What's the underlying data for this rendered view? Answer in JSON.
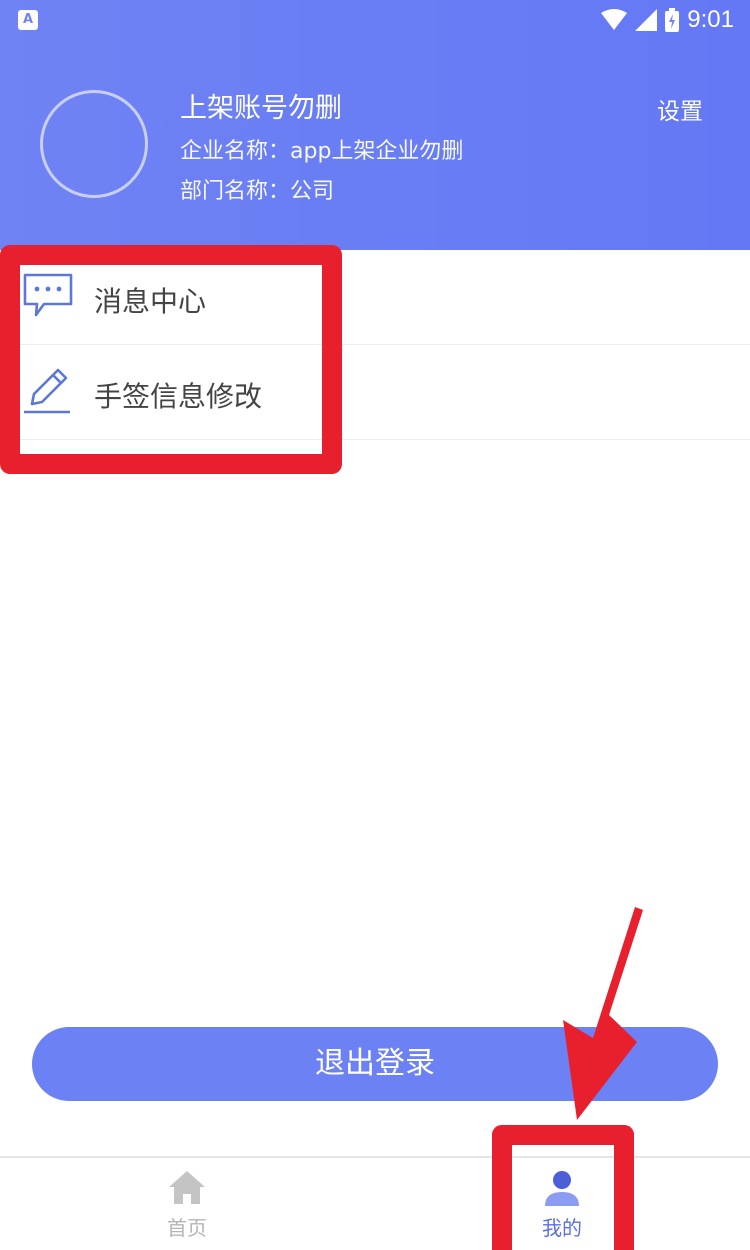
{
  "status_bar": {
    "app_icon_letter": "A",
    "time": "9:01"
  },
  "profile": {
    "name": "上架账号勿删",
    "company": "企业名称：app上架企业勿删",
    "department": "部门名称：公司",
    "settings_label": "设置"
  },
  "menu": {
    "items": [
      {
        "label": "消息中心",
        "icon": "chat-bubble-icon"
      },
      {
        "label": "手签信息修改",
        "icon": "pen-icon"
      }
    ]
  },
  "logout_label": "退出登录",
  "bottom_nav": {
    "tabs": [
      {
        "label": "首页",
        "icon": "home-icon",
        "active": false
      },
      {
        "label": "我的",
        "icon": "user-icon",
        "active": true
      }
    ]
  },
  "colors": {
    "header_gradient_start": "#6f83f4",
    "header_gradient_end": "#6478f5",
    "accent": "#6c82f4",
    "annotation_red": "#e8202e",
    "inactive_gray": "#b5b5b5"
  }
}
